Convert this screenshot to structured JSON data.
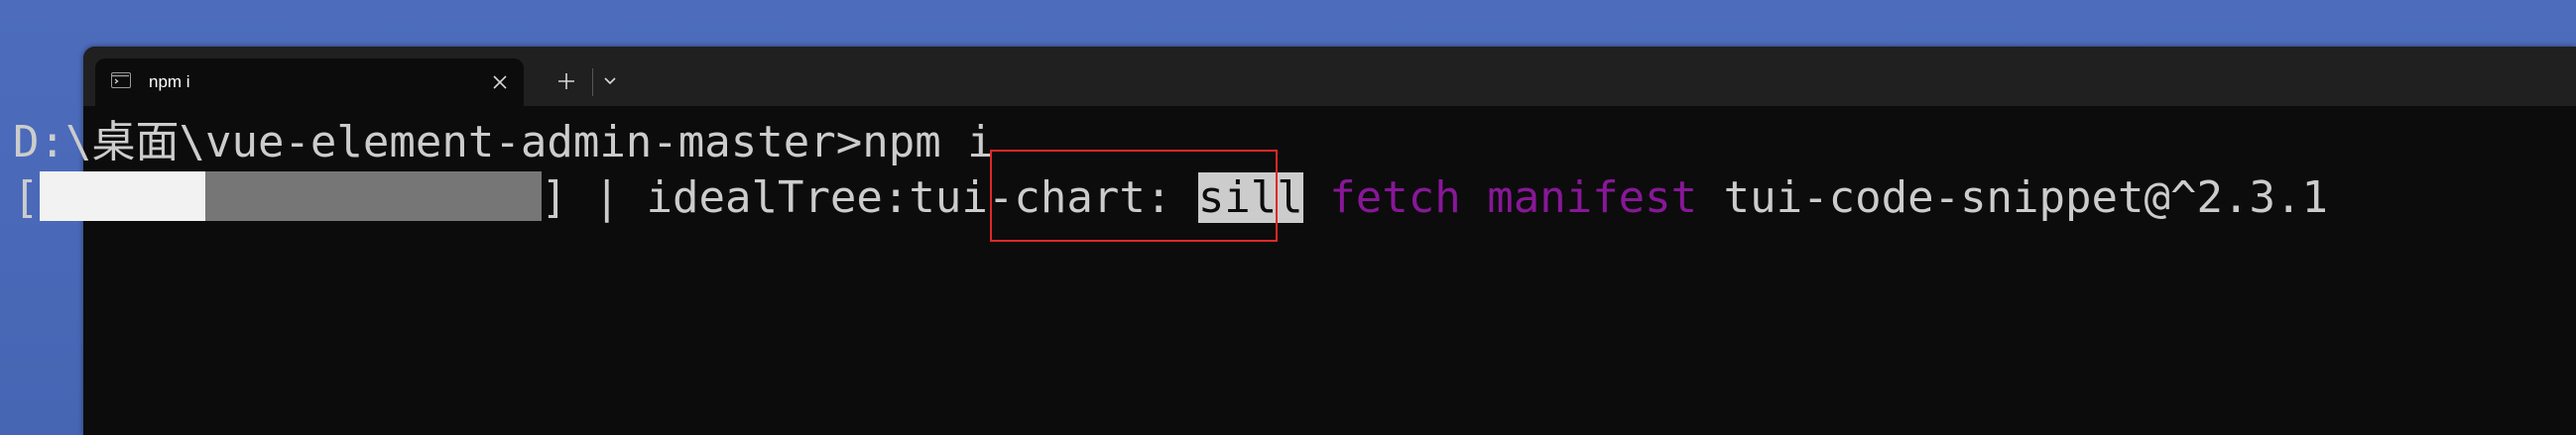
{
  "window": {
    "tab_title": "npm i",
    "tab_icon": "terminal-icon",
    "close_icon": "close-icon",
    "new_tab_icon": "plus-icon",
    "dropdown_icon": "chevron-down-icon"
  },
  "terminal": {
    "line1": {
      "prompt": "D:\\桌面\\vue-element-admin-master>",
      "command": "npm i"
    },
    "line2": {
      "progress_fraction": 0.33,
      "bracket_open": "[",
      "bracket_close": "]",
      "spinner": "|",
      "stage": "idealTree:tui-chart:",
      "level": "sill",
      "word_fetch": "fetch",
      "word_manifest": "manifest",
      "package": "tui-code-snippet@^2.3.1"
    }
  },
  "colors": {
    "background": "#0c0c0c",
    "text": "#cccccc",
    "magenta": "#881798",
    "highlight_box": "#e02828",
    "progress_done": "#f2f2f2",
    "progress_remaining": "#767676",
    "desktop": "#4a6ab8"
  }
}
